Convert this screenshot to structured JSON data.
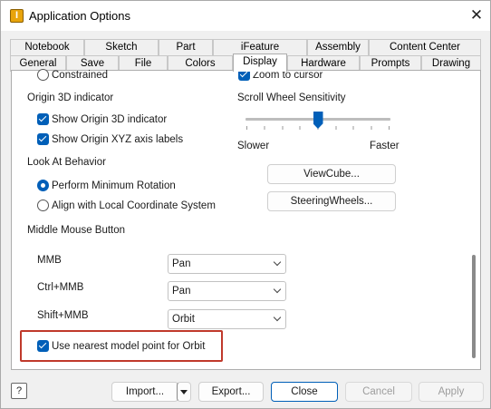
{
  "window": {
    "title": "Application Options",
    "close_glyph": "✕",
    "app_icon": "I"
  },
  "tabs": {
    "row1": [
      "Notebook",
      "Sketch",
      "Part",
      "iFeature",
      "Assembly",
      "Content Center"
    ],
    "row2": [
      "General",
      "Save",
      "File",
      "Colors",
      "Display",
      "Hardware",
      "Prompts",
      "Drawing"
    ],
    "active": "Display"
  },
  "content": {
    "constrained_label": "Constrained",
    "zoom_to_cursor_label": "Zoom to cursor",
    "origin_section": "Origin 3D indicator",
    "show_origin_3d": "Show Origin 3D indicator",
    "show_origin_xyz": "Show Origin XYZ axis labels",
    "scroll_section": "Scroll Wheel Sensitivity",
    "scroll_slower": "Slower",
    "scroll_faster": "Faster",
    "scroll_value": 0.5,
    "look_at_section": "Look At Behavior",
    "perform_min_rotation": "Perform Minimum Rotation",
    "align_local_cs": "Align with Local Coordinate System",
    "viewcube_btn": "ViewCube...",
    "steeringwheels_btn": "SteeringWheels...",
    "mmb_section": "Middle Mouse Button",
    "mmb_label": "MMB",
    "mmb_value": "Pan",
    "ctrl_mmb_label": "Ctrl+MMB",
    "ctrl_mmb_value": "Pan",
    "shift_mmb_label": "Shift+MMB",
    "shift_mmb_value": "Orbit",
    "nearest_point_label": "Use nearest model point for Orbit"
  },
  "footer": {
    "help": "?",
    "import": "Import...",
    "export": "Export...",
    "close": "Close",
    "cancel": "Cancel",
    "apply": "Apply"
  },
  "colors": {
    "accent": "#005fb8",
    "highlight_box": "#c0392b"
  }
}
